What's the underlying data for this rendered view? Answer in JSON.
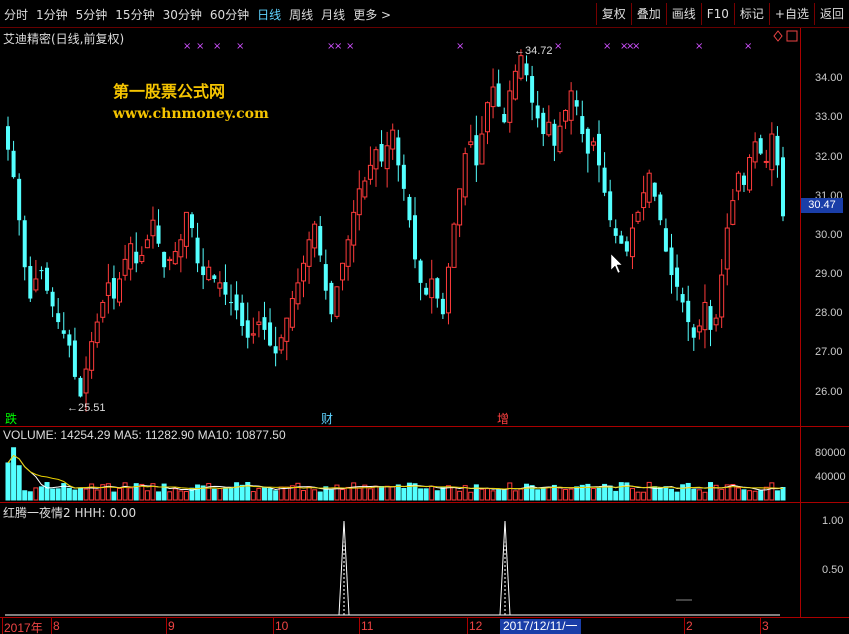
{
  "toolbar": {
    "periods": [
      "分时",
      "1分钟",
      "5分钟",
      "15分钟",
      "30分钟",
      "60分钟",
      "日线",
      "周线",
      "月线",
      "更多 >"
    ],
    "active_period": "日线",
    "right_buttons": [
      "复权",
      "叠加",
      "画线",
      "F10",
      "标记",
      "+自选",
      "返回"
    ]
  },
  "chart": {
    "title": "艾迪精密(日线,前复权)",
    "watermark_line1": "第一股票公式网",
    "watermark_line2": "www.chnmoney.com",
    "current_price": "30.47",
    "high_label": "34.72",
    "low_label": "25.51",
    "signals": [
      {
        "text": "跌",
        "color": "#00ff00"
      },
      {
        "text": "财",
        "color": "#5fd3ff"
      },
      {
        "text": "增",
        "color": "#ff4040"
      }
    ],
    "y_ticks": [
      "34.00",
      "33.00",
      "32.00",
      "31.00",
      "30.00",
      "29.00",
      "28.00",
      "27.00",
      "26.00"
    ]
  },
  "volume": {
    "label": "VOLUME: 14254.29  MA5: 11282.90  MA10: 10877.50",
    "y_ticks": [
      "80000",
      "40000"
    ]
  },
  "indicator": {
    "label": "红腾一夜情2  HHH: 0.00",
    "y_ticks": [
      "1.00",
      "0.50"
    ]
  },
  "x_axis": {
    "labels": [
      "2017年",
      "8",
      "9",
      "10",
      "11",
      "12",
      "2",
      "3"
    ],
    "cursor_date": "2017/12/11/一"
  },
  "colors": {
    "up": "#ff3b3b",
    "down": "#54ffff",
    "frame": "#aa0000",
    "accent": "#1a3ea8",
    "watermark": "#f5c400"
  },
  "chart_data": {
    "type": "candlestick",
    "title": "艾迪精密(日线,前复权)",
    "ylim": [
      25.3,
      35.0
    ],
    "high": 34.72,
    "low": 25.51,
    "last": 30.47,
    "close_path": [
      32.2,
      31.5,
      30.4,
      29.2,
      28.4,
      28.9,
      29.1,
      28.6,
      28.2,
      27.8,
      27.5,
      27.2,
      26.4,
      25.9,
      26.6,
      27.3,
      27.8,
      28.3,
      28.8,
      28.4,
      28.9,
      29.4,
      29.8,
      29.3,
      29.5,
      29.9,
      30.4,
      29.8,
      29.2,
      29.4,
      29.6,
      29.9,
      30.6,
      30.2,
      29.3,
      29.0,
      29.2,
      28.9,
      28.8,
      28.5,
      28.3,
      28.1,
      27.7,
      27.4,
      27.5,
      27.8,
      27.6,
      27.2,
      27.0,
      27.4,
      27.9,
      28.4,
      28.8,
      29.3,
      29.9,
      30.3,
      29.5,
      28.6,
      28.0,
      28.7,
      29.3,
      29.9,
      30.6,
      31.2,
      31.4,
      31.8,
      32.2,
      31.9,
      32.3,
      32.7,
      31.8,
      31.2,
      30.4,
      29.4,
      28.8,
      28.5,
      28.9,
      28.4,
      28.0,
      29.2,
      30.3,
      31.2,
      32.1,
      32.4,
      31.8,
      32.6,
      33.4,
      33.8,
      33.3,
      32.9,
      33.7,
      34.2,
      34.6,
      34.1,
      33.4,
      33.0,
      32.6,
      32.9,
      32.3,
      32.8,
      33.2,
      33.7,
      33.3,
      32.6,
      32.1,
      32.4,
      31.8,
      31.1,
      30.4,
      30.0,
      29.8,
      29.6,
      30.2,
      30.6,
      31.1,
      31.6,
      31.0,
      30.4,
      29.6,
      29.0,
      28.7,
      28.3,
      27.8,
      27.4,
      27.7,
      28.3,
      27.6,
      27.9,
      29.0,
      30.2,
      30.9,
      31.6,
      31.3,
      32.0,
      32.4,
      32.1,
      31.9,
      32.6,
      31.8,
      30.5
    ]
  }
}
